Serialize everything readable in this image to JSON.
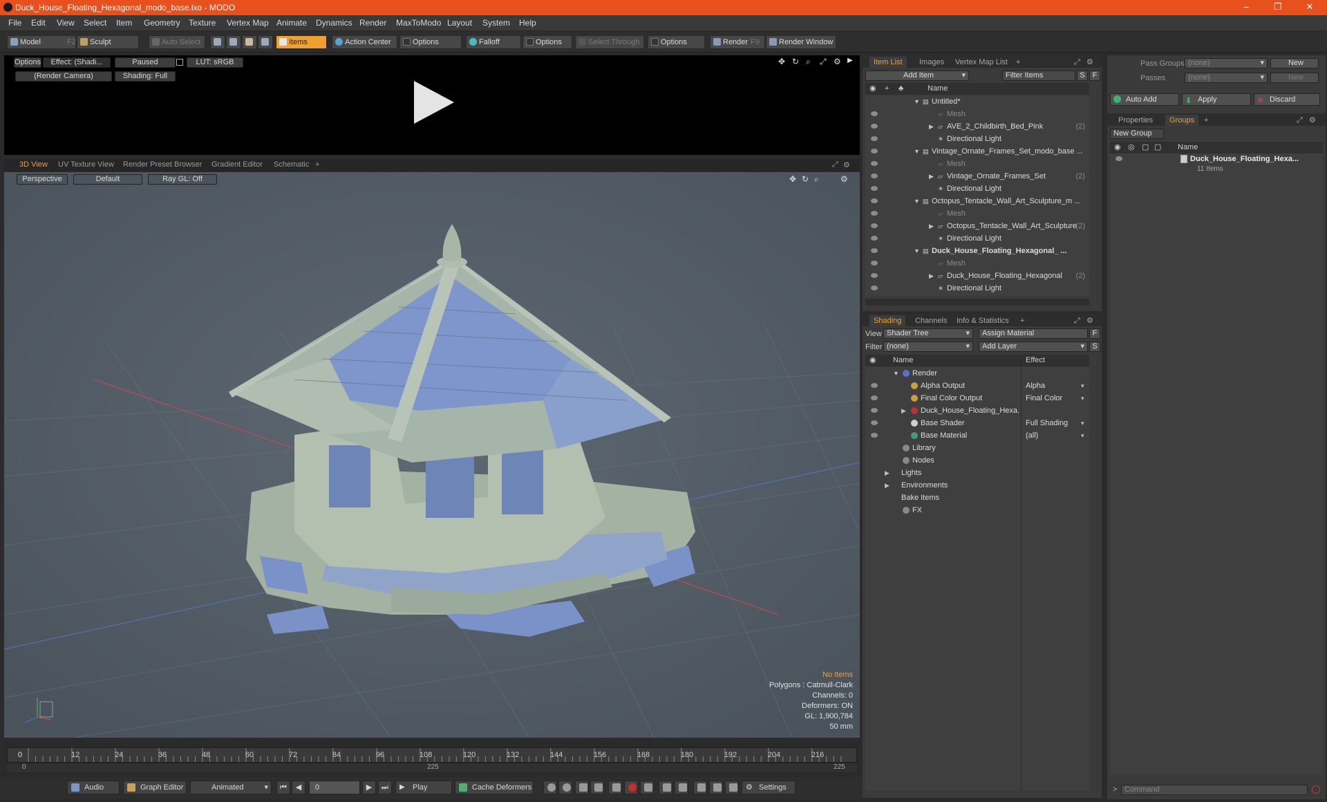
{
  "window": {
    "title": "Duck_House_Floating_Hexagonal_modo_base.lxo - MODO",
    "min": "–",
    "max": "❐",
    "close": "✕"
  },
  "menu": [
    "File",
    "Edit",
    "View",
    "Select",
    "Item",
    "Geometry",
    "Texture",
    "Vertex Map",
    "Animate",
    "Dynamics",
    "Render",
    "MaxToModo",
    "Layout",
    "System",
    "Help"
  ],
  "toolbar": {
    "model": "Model",
    "model_key": "F2",
    "sculpt": "Sculpt",
    "auto_select": "Auto Select",
    "items": "Items",
    "action_center": "Action Center",
    "options1": "Options",
    "falloff": "Falloff",
    "options2": "Options",
    "select_through": "Select Through",
    "options3": "Options",
    "render": "Render",
    "render_key": "F9",
    "render_window": "Render Window"
  },
  "render_view": {
    "options": "Options",
    "effect": "Effect: (Shadi...",
    "paused": "Paused",
    "lut": "LUT: sRGB",
    "camera": "(Render Camera)",
    "shading": "Shading: Full"
  },
  "view_tabs": [
    "3D View",
    "UV Texture View",
    "Render Preset Browser",
    "Gradient Editor",
    "Schematic",
    "+"
  ],
  "viewport": {
    "projection": "Perspective",
    "style": "Default",
    "raygl": "Ray GL: Off",
    "stats": {
      "items": "No Items",
      "polygons": "Polygons : Catmull-Clark",
      "channels": "Channels: 0",
      "deformers": "Deformers: ON",
      "gl": "GL: 1,900,784",
      "focal": "50 mm"
    }
  },
  "timeline": {
    "ticks": [
      "0",
      "12",
      "24",
      "36",
      "48",
      "60",
      "72",
      "84",
      "96",
      "108",
      "120",
      "132",
      "144",
      "156",
      "168",
      "180",
      "192",
      "204",
      "216"
    ],
    "start": "0",
    "mid": "225",
    "end": "225"
  },
  "bottombar": {
    "audio": "Audio",
    "graph_editor": "Graph Editor",
    "animated": "Animated",
    "frame": "0",
    "play": "Play",
    "cache": "Cache Deformers",
    "settings": "Settings"
  },
  "item_list": {
    "tabs": [
      "Item List",
      "Images",
      "Vertex Map List",
      "+"
    ],
    "add_item": "Add Item",
    "filter": "Filter Items",
    "s": "S",
    "f": "F",
    "col_name": "Name",
    "rows": [
      {
        "label": "Untitled*",
        "indent": 0,
        "arrow": "▼",
        "dim": false,
        "bold": false,
        "count": ""
      },
      {
        "label": "Mesh",
        "indent": 1,
        "arrow": "",
        "dim": true,
        "bold": false,
        "count": ""
      },
      {
        "label": "AVE_2_Childbirth_Bed_Pink",
        "indent": 1,
        "arrow": "▶",
        "dim": false,
        "bold": false,
        "count": "(2)"
      },
      {
        "label": "Directional Light",
        "indent": 1,
        "arrow": "",
        "dim": false,
        "bold": false,
        "count": ""
      },
      {
        "label": "Vintage_Ornate_Frames_Set_modo_base ...",
        "indent": 0,
        "arrow": "▼",
        "dim": false,
        "bold": false,
        "count": ""
      },
      {
        "label": "Mesh",
        "indent": 1,
        "arrow": "",
        "dim": true,
        "bold": false,
        "count": ""
      },
      {
        "label": "Vintage_Ornate_Frames_Set",
        "indent": 1,
        "arrow": "▶",
        "dim": false,
        "bold": false,
        "count": "(2)"
      },
      {
        "label": "Directional Light",
        "indent": 1,
        "arrow": "",
        "dim": false,
        "bold": false,
        "count": ""
      },
      {
        "label": "Octopus_Tentacle_Wall_Art_Sculpture_m ...",
        "indent": 0,
        "arrow": "▼",
        "dim": false,
        "bold": false,
        "count": ""
      },
      {
        "label": "Mesh",
        "indent": 1,
        "arrow": "",
        "dim": true,
        "bold": false,
        "count": ""
      },
      {
        "label": "Octopus_Tentacle_Wall_Art_Sculpture",
        "indent": 1,
        "arrow": "▶",
        "dim": false,
        "bold": false,
        "count": "(2)"
      },
      {
        "label": "Directional Light",
        "indent": 1,
        "arrow": "",
        "dim": false,
        "bold": false,
        "count": ""
      },
      {
        "label": "Duck_House_Floating_Hexagonal_ ...",
        "indent": 0,
        "arrow": "▼",
        "dim": false,
        "bold": true,
        "count": ""
      },
      {
        "label": "Mesh",
        "indent": 1,
        "arrow": "",
        "dim": true,
        "bold": false,
        "count": ""
      },
      {
        "label": "Duck_House_Floating_Hexagonal",
        "indent": 1,
        "arrow": "▶",
        "dim": false,
        "bold": false,
        "count": "(2)"
      },
      {
        "label": "Directional Light",
        "indent": 1,
        "arrow": "",
        "dim": false,
        "bold": false,
        "count": ""
      }
    ]
  },
  "shading": {
    "tabs": [
      "Shading",
      "Channels",
      "Info & Statistics",
      "+"
    ],
    "view_label": "View",
    "view_value": "Shader Tree",
    "assign": "Assign Material",
    "filter_label": "Filter",
    "filter_value": "(none)",
    "add_layer": "Add Layer",
    "f": "F",
    "s": "S",
    "col_name": "Name",
    "col_effect": "Effect",
    "rows": [
      {
        "label": "Render",
        "indent": 0,
        "arrow": "▼",
        "effect": "",
        "eye": false,
        "ic": "#5a6fd0"
      },
      {
        "label": "Alpha Output",
        "indent": 1,
        "arrow": "",
        "effect": "Alpha",
        "eye": true,
        "ic": "#c8a040"
      },
      {
        "label": "Final Color Output",
        "indent": 1,
        "arrow": "",
        "effect": "Final Color",
        "eye": true,
        "ic": "#c8a040"
      },
      {
        "label": "Duck_House_Floating_Hexa...",
        "indent": 1,
        "arrow": "▶",
        "effect": "",
        "eye": true,
        "ic": "#c03030"
      },
      {
        "label": "Base Shader",
        "indent": 1,
        "arrow": "",
        "effect": "Full Shading",
        "eye": true,
        "ic": "#d0d0d0"
      },
      {
        "label": "Base Material",
        "indent": 1,
        "arrow": "",
        "effect": "(all)",
        "eye": true,
        "ic": "#40a070"
      },
      {
        "label": "Library",
        "indent": 0,
        "arrow": "",
        "effect": "",
        "eye": false,
        "ic": "#888"
      },
      {
        "label": "Nodes",
        "indent": 0,
        "arrow": "",
        "effect": "",
        "eye": false,
        "ic": "#888"
      },
      {
        "label": "Lights",
        "indent": -1,
        "arrow": "▶",
        "effect": "",
        "eye": false,
        "ic": ""
      },
      {
        "label": "Environments",
        "indent": -1,
        "arrow": "▶",
        "effect": "",
        "eye": false,
        "ic": ""
      },
      {
        "label": "Bake Items",
        "indent": -1,
        "arrow": "",
        "effect": "",
        "eye": false,
        "ic": ""
      },
      {
        "label": "FX",
        "indent": 0,
        "arrow": "",
        "effect": "",
        "eye": false,
        "ic": "#888"
      }
    ]
  },
  "groups": {
    "pass_groups_label": "Pass Groups",
    "pass_groups_value": "(none)",
    "new1": "New",
    "passes_label": "Passes",
    "passes_value": "(none)",
    "new2": "New",
    "auto_add": "Auto Add",
    "apply": "Apply",
    "discard": "Discard",
    "tabs": [
      "Properties",
      "Groups",
      "+"
    ],
    "new_group": "New Group",
    "col_name": "Name",
    "group_name": "Duck_House_Floating_Hexa...",
    "group_count": "11 Items",
    "command": "Command"
  }
}
